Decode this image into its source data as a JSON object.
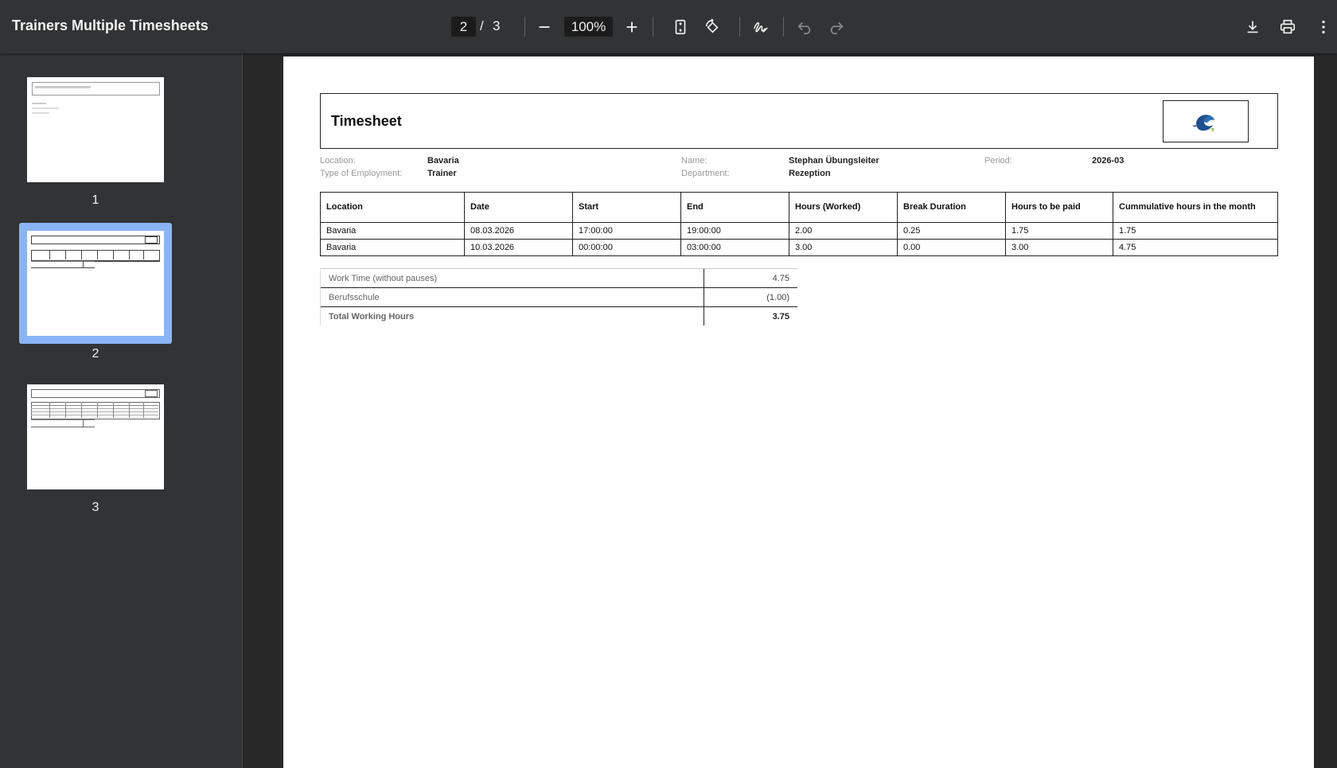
{
  "toolbar": {
    "title": "Trainers Multiple Timesheets",
    "current_page": "2",
    "page_separator": "/",
    "total_pages": "3",
    "zoom": "100%",
    "icons": [
      "minus-icon",
      "plus-icon",
      "fit-page-icon",
      "rotate-icon",
      "draw-icon",
      "undo-icon",
      "redo-icon",
      "download-icon",
      "print-icon",
      "more-vert-icon"
    ]
  },
  "sidebar": {
    "thumbnails": [
      {
        "label": "1",
        "selected": false
      },
      {
        "label": "2",
        "selected": true
      },
      {
        "label": "3",
        "selected": false
      }
    ],
    "accent": "#8ab4f8"
  },
  "document": {
    "heading": "Timesheet",
    "meta": {
      "location_label": "Location:",
      "location_value": "Bavaria",
      "employment_label": "Type of Employment:",
      "employment_value": "Trainer",
      "name_label": "Name:",
      "name_value": "Stephan Übungsleiter",
      "department_label": "Department:",
      "department_value": "Rezeption",
      "period_label": "Period:",
      "period_value": "2026-03"
    },
    "table": {
      "headers": [
        "Location",
        "Date",
        "Start",
        "End",
        "Hours (Worked)",
        "Break Duration",
        "Hours to be paid",
        "Cummulative hours in the month"
      ],
      "rows": [
        [
          "Bavaria",
          "08.03.2026",
          "17:00:00",
          "19:00:00",
          "2.00",
          "0.25",
          "1.75",
          "1.75"
        ],
        [
          "Bavaria",
          "10.03.2026",
          "00:00:00",
          "03:00:00",
          "3.00",
          "0.00",
          "3.00",
          "4.75"
        ]
      ]
    },
    "summary": [
      {
        "label": "Work Time (without pauses)",
        "value": "4.75"
      },
      {
        "label": "Berufsschule",
        "value": "(1.00)"
      },
      {
        "label": "Total Working Hours",
        "value": "3.75"
      }
    ]
  }
}
